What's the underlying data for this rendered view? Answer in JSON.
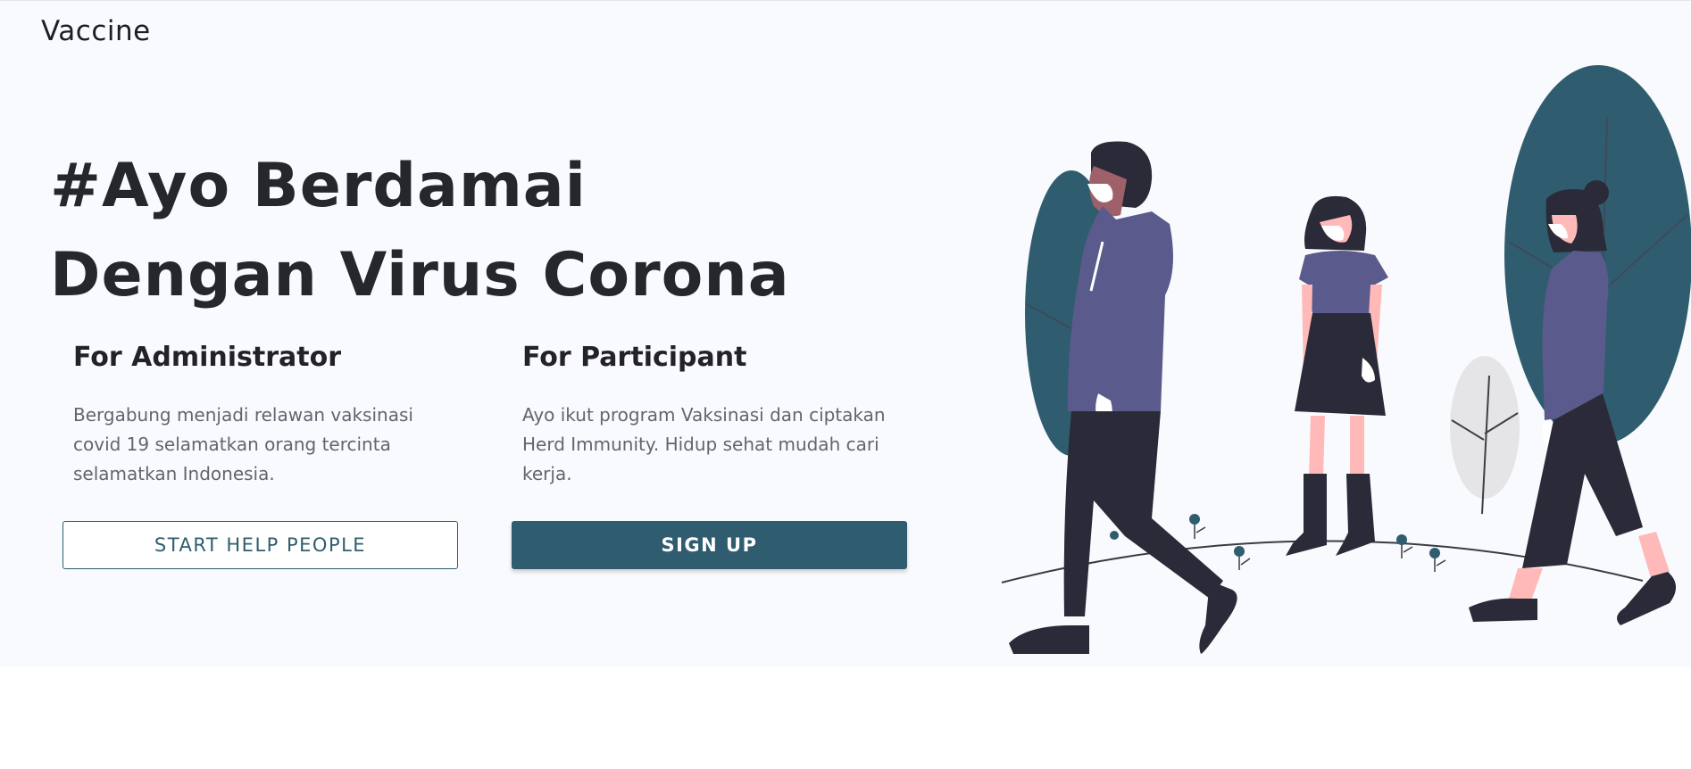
{
  "brand": {
    "name": "Vaccine"
  },
  "hero": {
    "headline": "#Ayo Berdamai Dengan Virus Corona"
  },
  "cards": {
    "admin": {
      "title": "For Administrator",
      "description": "Bergabung menjadi relawan vaksinasi covid 19 selamatkan orang tercinta selamatkan Indonesia.",
      "button_label": "START HELP PEOPLE"
    },
    "participant": {
      "title": "For Participant",
      "description": "Ayo ikut program Vaksinasi dan ciptakan Herd Immunity. Hidup sehat mudah cari kerja.",
      "button_label": "SIGN UP"
    }
  },
  "colors": {
    "accent": "#2f5d6f",
    "hero_background": "#f9fafd",
    "dark": "#2b2a38",
    "purple": "#5b5a8c",
    "skin": "#ffb9b9"
  },
  "illustration": {
    "icon": "people-walking-with-masks-illustration"
  }
}
